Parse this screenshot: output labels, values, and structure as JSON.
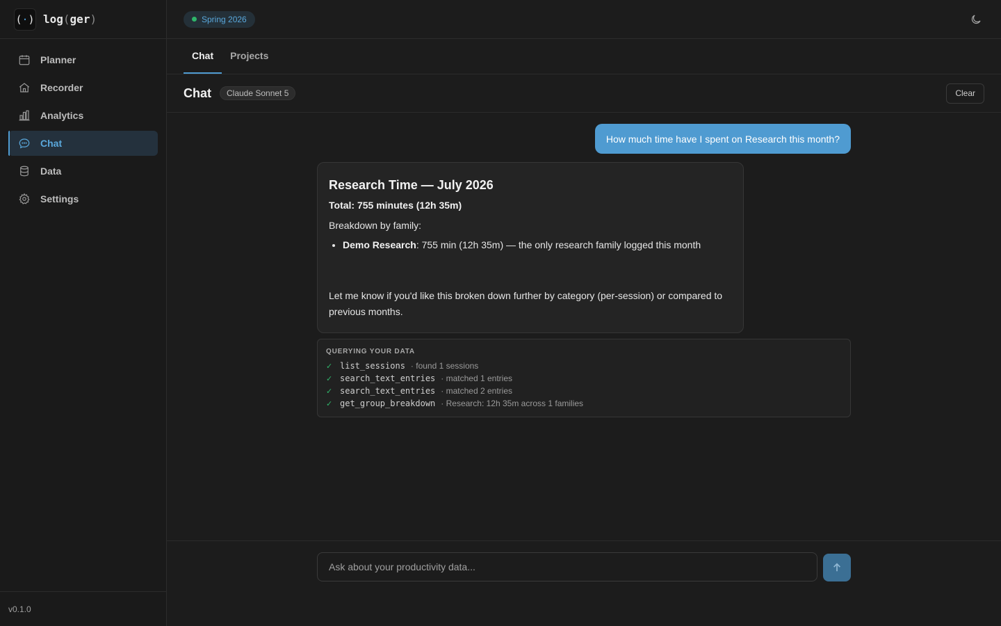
{
  "brand": {
    "logo_text": "(·)",
    "name_pre": "log",
    "name_open": "(",
    "name_mid": "ger",
    "name_close": ")"
  },
  "sidebar": {
    "items": [
      {
        "label": "Planner",
        "icon": "calendar-icon",
        "active": false
      },
      {
        "label": "Recorder",
        "icon": "home-icon",
        "active": false
      },
      {
        "label": "Analytics",
        "icon": "bar-chart-icon",
        "active": false
      },
      {
        "label": "Chat",
        "icon": "chat-bubble-icon",
        "active": true
      },
      {
        "label": "Data",
        "icon": "database-icon",
        "active": false
      },
      {
        "label": "Settings",
        "icon": "gear-icon",
        "active": false
      }
    ],
    "version": "v0.1.0"
  },
  "topbar": {
    "semester": "Spring 2026",
    "theme_icon": "moon-icon"
  },
  "tabs": [
    {
      "label": "Chat",
      "active": true
    },
    {
      "label": "Projects",
      "active": false
    }
  ],
  "chat": {
    "title": "Chat",
    "model": "Claude Sonnet 5",
    "clear_label": "Clear",
    "user_message": "How much time have I spent on Research this month?",
    "assistant": {
      "heading": "Research Time — July 2026",
      "total": "Total: 755 minutes (12h 35m)",
      "breakdown_label": "Breakdown by family:",
      "item_bold": "Demo Research",
      "item_rest": ": 755 min (12h 35m) — the only research family logged this month",
      "followup": "Let me know if you'd like this broken down further by category (per-session) or compared to previous months."
    },
    "tools": {
      "heading": "QUERYING YOUR DATA",
      "calls": [
        {
          "fn": "list_sessions",
          "result": "· found 1 sessions"
        },
        {
          "fn": "search_text_entries",
          "result": "· matched 1 entries"
        },
        {
          "fn": "search_text_entries",
          "result": "· matched 2 entries"
        },
        {
          "fn": "get_group_breakdown",
          "result": "· Research: 12h 35m across 1 families"
        }
      ]
    },
    "composer": {
      "placeholder": "Ask about your productivity data...",
      "send_icon": "arrow-up-icon"
    }
  },
  "colors": {
    "accent": "#4f9bd1",
    "success": "#2fb56a",
    "background": "#1c1c1c"
  }
}
